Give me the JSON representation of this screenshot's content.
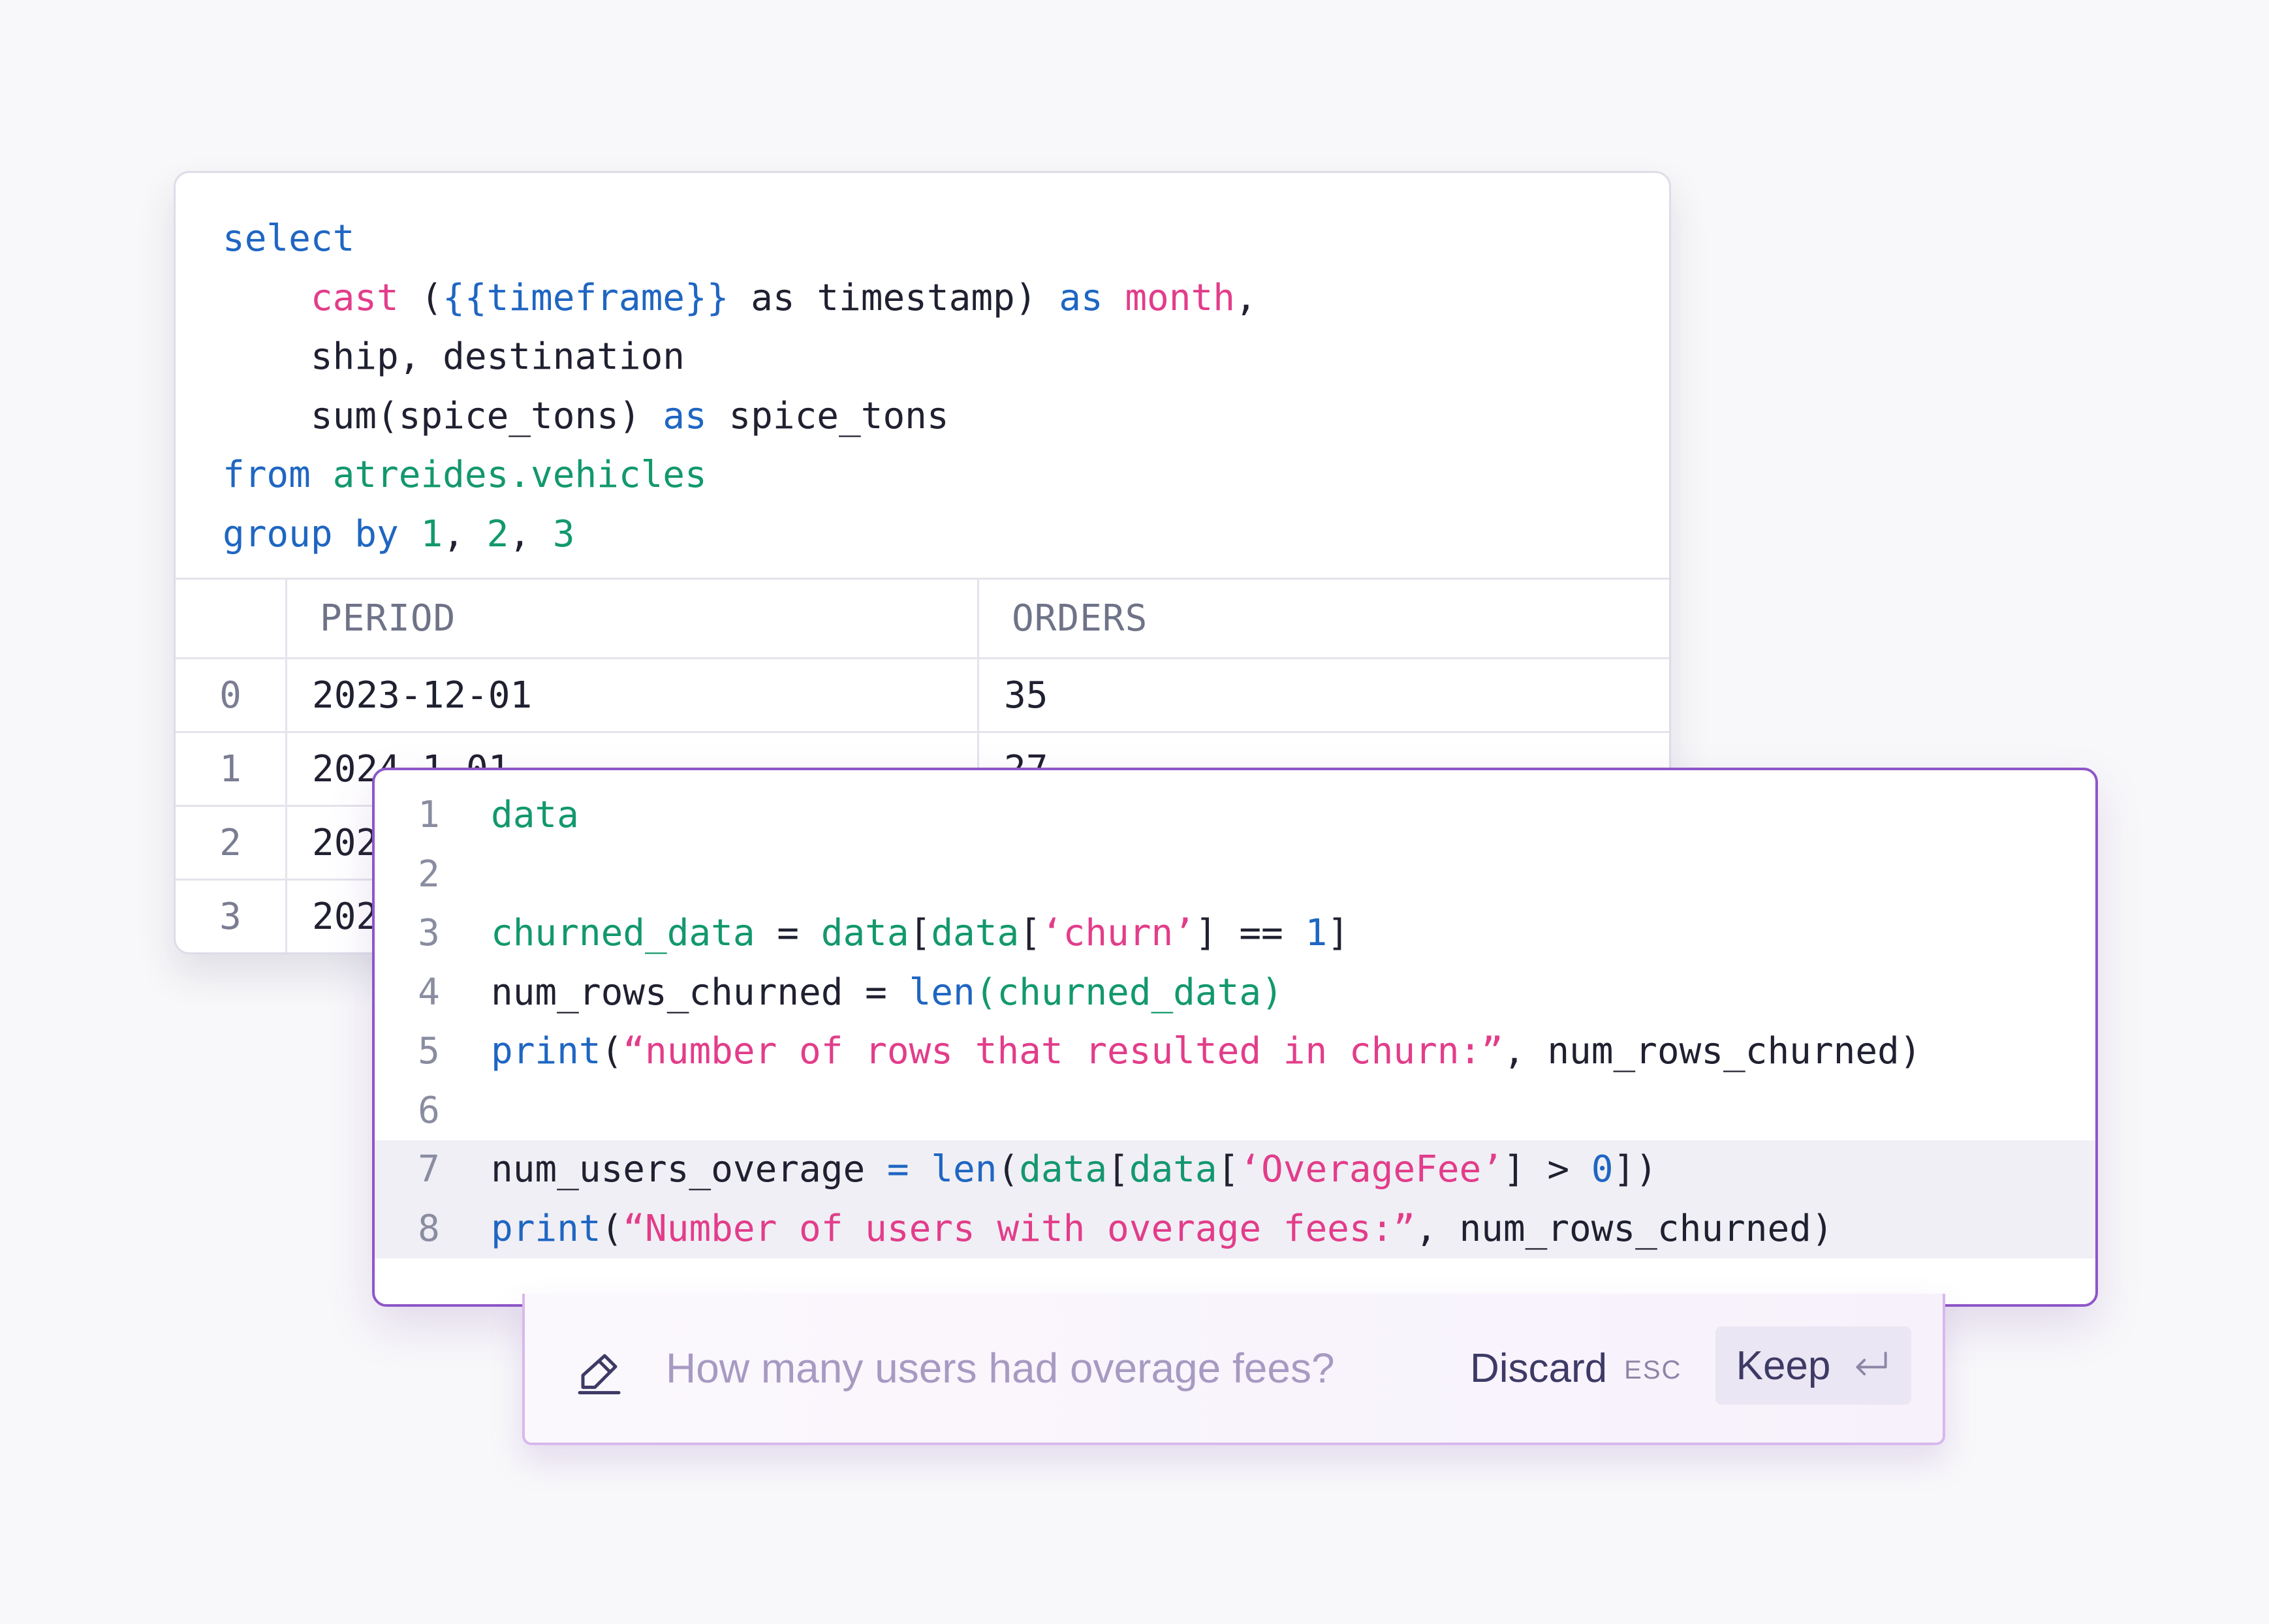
{
  "sql_card": {
    "code_lines": [
      [
        {
          "t": "select",
          "c": "blue"
        }
      ],
      [
        {
          "t": "    ",
          "c": "dark"
        },
        {
          "t": "cast",
          "c": "pink"
        },
        {
          "t": " (",
          "c": "dark"
        },
        {
          "t": "{{timeframe}}",
          "c": "blue"
        },
        {
          "t": " as timestamp) ",
          "c": "dark"
        },
        {
          "t": "as",
          "c": "blue"
        },
        {
          "t": " ",
          "c": "dark"
        },
        {
          "t": "month",
          "c": "pink"
        },
        {
          "t": ",",
          "c": "dark"
        }
      ],
      [
        {
          "t": "    ship, destination",
          "c": "dark"
        }
      ],
      [
        {
          "t": "    sum(spice_tons) ",
          "c": "dark"
        },
        {
          "t": "as",
          "c": "blue"
        },
        {
          "t": " spice_tons",
          "c": "dark"
        }
      ],
      [
        {
          "t": "from",
          "c": "blue"
        },
        {
          "t": " ",
          "c": "dark"
        },
        {
          "t": "atreides.vehicles",
          "c": "green"
        }
      ],
      [
        {
          "t": "group by",
          "c": "blue"
        },
        {
          "t": " ",
          "c": "dark"
        },
        {
          "t": "1",
          "c": "green"
        },
        {
          "t": ", ",
          "c": "dark"
        },
        {
          "t": "2",
          "c": "green"
        },
        {
          "t": ", ",
          "c": "dark"
        },
        {
          "t": "3",
          "c": "green"
        }
      ]
    ],
    "table": {
      "columns": [
        "PERIOD",
        "ORDERS"
      ],
      "rows": [
        {
          "index": "0",
          "period": "2023-12-01",
          "orders": "35"
        },
        {
          "index": "1",
          "period": "2024-1-01",
          "orders": "27"
        },
        {
          "index": "2",
          "period": "2024-2-01",
          "orders": ""
        },
        {
          "index": "3",
          "period": "2024-3-01",
          "orders": ""
        }
      ]
    }
  },
  "python_card": {
    "lines": [
      {
        "num": "1",
        "highlight": false,
        "tokens": [
          {
            "t": "data",
            "c": "green"
          }
        ]
      },
      {
        "num": "2",
        "highlight": false,
        "tokens": []
      },
      {
        "num": "3",
        "highlight": false,
        "tokens": [
          {
            "t": "churned_data",
            "c": "green"
          },
          {
            "t": " = ",
            "c": "dark"
          },
          {
            "t": "data",
            "c": "green"
          },
          {
            "t": "[",
            "c": "dark"
          },
          {
            "t": "data",
            "c": "green"
          },
          {
            "t": "[",
            "c": "dark"
          },
          {
            "t": "‘churn’",
            "c": "pink"
          },
          {
            "t": "] == ",
            "c": "dark"
          },
          {
            "t": "1",
            "c": "blue"
          },
          {
            "t": "]",
            "c": "dark"
          }
        ]
      },
      {
        "num": "4",
        "highlight": false,
        "tokens": [
          {
            "t": "num_rows_churned = ",
            "c": "dark"
          },
          {
            "t": "len",
            "c": "blue"
          },
          {
            "t": "(churned_data)",
            "c": "green"
          }
        ]
      },
      {
        "num": "5",
        "highlight": false,
        "tokens": [
          {
            "t": "print",
            "c": "blue"
          },
          {
            "t": "(",
            "c": "dark"
          },
          {
            "t": "“number of rows that resulted in churn:”",
            "c": "pink"
          },
          {
            "t": ", num_rows_churned)",
            "c": "dark"
          }
        ]
      },
      {
        "num": "6",
        "highlight": false,
        "tokens": []
      },
      {
        "num": "7",
        "highlight": true,
        "tokens": [
          {
            "t": "num_users_overage ",
            "c": "dark"
          },
          {
            "t": "=",
            "c": "blue"
          },
          {
            "t": " ",
            "c": "dark"
          },
          {
            "t": "len",
            "c": "blue"
          },
          {
            "t": "(",
            "c": "dark"
          },
          {
            "t": "data",
            "c": "green"
          },
          {
            "t": "[",
            "c": "dark"
          },
          {
            "t": "data",
            "c": "green"
          },
          {
            "t": "[",
            "c": "dark"
          },
          {
            "t": "‘OverageFee’",
            "c": "pink"
          },
          {
            "t": "] > ",
            "c": "dark"
          },
          {
            "t": "0",
            "c": "blue"
          },
          {
            "t": "])",
            "c": "dark"
          }
        ]
      },
      {
        "num": "8",
        "highlight": true,
        "tokens": [
          {
            "t": "print",
            "c": "blue"
          },
          {
            "t": "(",
            "c": "dark"
          },
          {
            "t": "“Number of users with overage fees:”",
            "c": "pink"
          },
          {
            "t": ", num_rows_churned)",
            "c": "dark"
          }
        ]
      }
    ]
  },
  "prompt_bar": {
    "icon": "pencil-icon",
    "prompt": "How many users had overage fees?",
    "discard_label": "Discard",
    "discard_shortcut": "ESC",
    "keep_label": "Keep",
    "keep_icon": "enter-key-icon"
  },
  "colors": {
    "blue": "#1f66c2",
    "pink": "#e23d8a",
    "green": "#13986e",
    "dark": "#1f2030",
    "accent_border": "#8f56c8"
  }
}
